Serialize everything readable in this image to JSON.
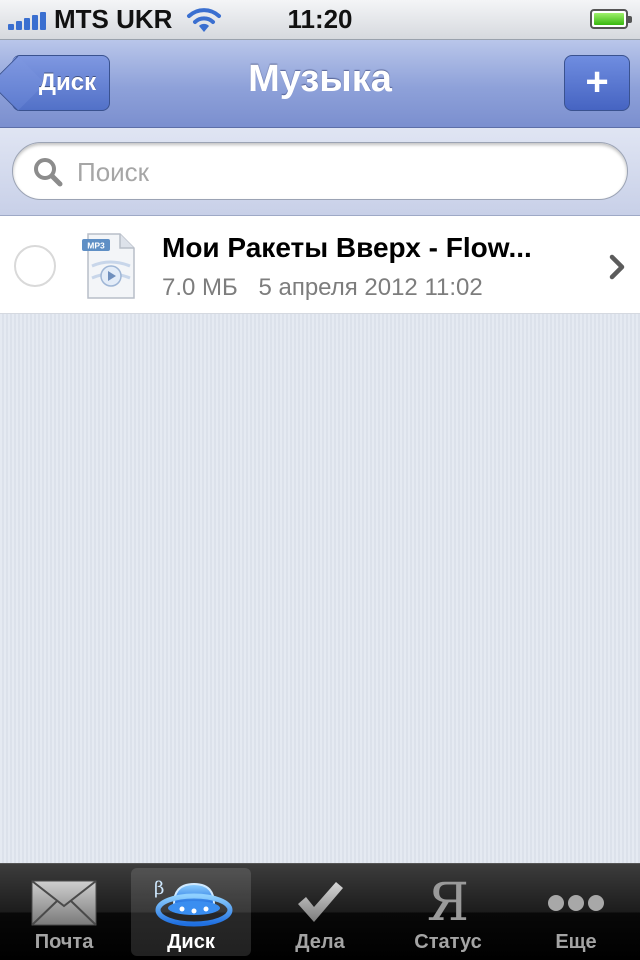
{
  "status_bar": {
    "carrier": "MTS UKR",
    "time": "11:20",
    "signal_bars": 5,
    "battery_level": 1.0,
    "icons": [
      "signal-bars-icon",
      "wifi-icon",
      "battery-icon"
    ]
  },
  "nav": {
    "back_label": "Диск",
    "title": "Музыка",
    "add_label": "+"
  },
  "search": {
    "placeholder": "Поиск",
    "value": ""
  },
  "files": [
    {
      "name": "Мои Ракеты Вверх - Flow...",
      "icon_badge": "MP3",
      "size": "7.0 МБ",
      "date": "5 апреля 2012 11:02"
    }
  ],
  "tab_bar": {
    "active": 1,
    "tabs": [
      {
        "label": "Почта",
        "icon": "envelope-icon"
      },
      {
        "label": "Диск",
        "icon": "ufo-icon",
        "badge": "β"
      },
      {
        "label": "Дела",
        "icon": "checkmark-icon"
      },
      {
        "label": "Статус",
        "icon": "ya-letter-icon",
        "glyph": "Я"
      },
      {
        "label": "Еще",
        "icon": "more-dots-icon"
      }
    ]
  },
  "colors": {
    "nav_bar": "#8ea1d9",
    "nav_button": "#5271c8",
    "background": "#dfe5ef",
    "tab_bar": "#1c1c1c",
    "active_tab_icon": "#2d7cf0"
  }
}
